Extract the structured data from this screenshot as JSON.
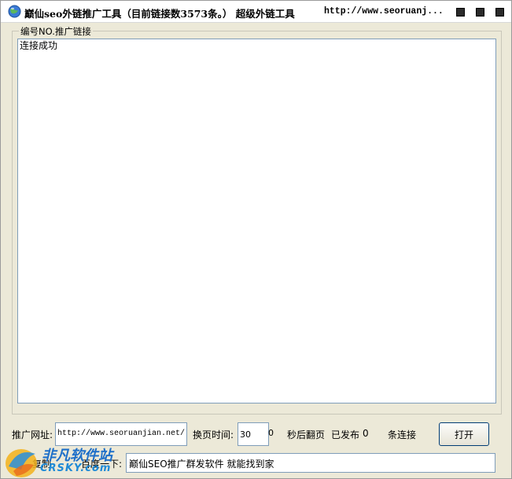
{
  "titlebar": {
    "title": "巅仙seo外链推广工具（目前链接数3573条。） 超级外链工具",
    "url": "http://www.seoruanj..."
  },
  "log": {
    "legend": "编号NO.推广链接",
    "lines": [
      "连接成功"
    ]
  },
  "controls": {
    "url_label": "推广网址:",
    "url_value": "http://www.seoruanjian.net/",
    "interval_label": "换页时间:",
    "interval_value": "30",
    "interval_extra": "0",
    "flip_label": "秒后翻页",
    "published_label": "已发布",
    "published_count": "0",
    "links_label": "条连接",
    "open_button": "打开"
  },
  "footer": {
    "copy_link": "复制",
    "search_tip": "百度一下:",
    "search_text": "巅仙SEO推广群发软件 就能找到家"
  },
  "watermark": {
    "text": "非凡软件站",
    "sub": "CRSKY.com"
  },
  "colors": {
    "window_bg": "#ece9d8",
    "border_blue": "#7f9db9",
    "watermark_blue": "#1e6fc9"
  },
  "icons": {
    "app": "globe-icon",
    "window_buttons": [
      "minimize-icon",
      "maximize-icon",
      "close-icon"
    ]
  }
}
